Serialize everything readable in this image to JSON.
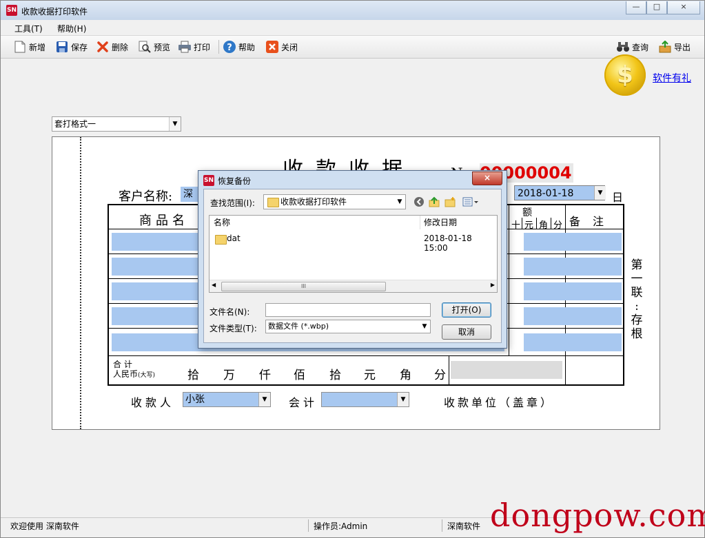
{
  "window": {
    "title": "收款收据打印软件",
    "app_icon": "SN",
    "minimize": "—",
    "maximize": "□",
    "close": "×"
  },
  "menu": [
    {
      "label": "工具(T)"
    },
    {
      "label": "帮助(H)"
    }
  ],
  "toolbar": {
    "new": "新增",
    "save": "保存",
    "delete": "删除",
    "preview": "预览",
    "print": "打印",
    "help": "帮助",
    "close": "关闭",
    "query": "查询",
    "export": "导出"
  },
  "promo": {
    "coin_symbol": "$",
    "link": "软件有礼"
  },
  "format_select": {
    "value": "套打格式一"
  },
  "receipt": {
    "title": "收款收据",
    "no_label": "No",
    "no_value": "00000004",
    "customer_label": "客户名称:",
    "customer_value": "深",
    "date": "2018-01-18",
    "day_label": "日",
    "col_name": "商品名",
    "col_amount": "额",
    "digits": [
      "十",
      "元",
      "角",
      "分"
    ],
    "col_notes": "备注",
    "total_label_1": "合 计",
    "total_label_2": "人民币",
    "total_label_sub": "(大写)",
    "upper_units": [
      "拾",
      "万",
      "仟",
      "佰",
      "拾",
      "元",
      "角",
      "分"
    ],
    "side_text": [
      "第",
      "一",
      "联",
      ":",
      "存",
      "根"
    ],
    "payee_label": "收款人",
    "payee_value": "小张",
    "accountant_label": "会计",
    "unit_label": "收款单位（盖章）"
  },
  "dialog": {
    "title": "恢复备份",
    "icon": "SN",
    "close": "×",
    "lookin_label": "查找范围(I):",
    "lookin_value": "收款收据打印软件",
    "col_name": "名称",
    "col_date": "修改日期",
    "files": [
      {
        "name": "dat",
        "date": "2018-01-18 15:00"
      }
    ],
    "scroll_thumb": "III",
    "filename_label": "文件名(N):",
    "filename_value": "",
    "filetype_label": "文件类型(T):",
    "filetype_value": "数据文件 (*.wbp)",
    "open_button": "打开(O)",
    "cancel_button": "取消"
  },
  "status": {
    "welcome": "欢迎使用 深南软件",
    "operator": "操作员:Admin",
    "company": "深南软件"
  },
  "watermark": "dongpow.com"
}
